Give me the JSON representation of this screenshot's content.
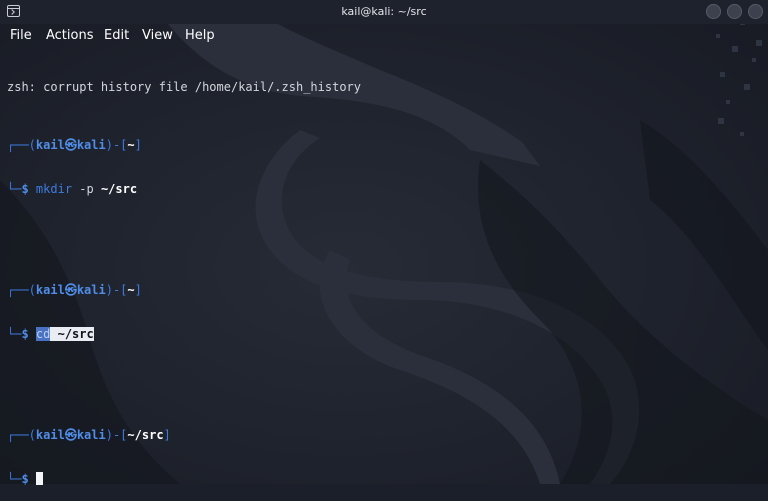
{
  "window": {
    "title": "kail@kali: ~/src"
  },
  "menu": {
    "items": [
      "File",
      "Actions",
      "Edit",
      "View",
      "Help"
    ]
  },
  "terminal": {
    "warning": "zsh: corrupt history file /home/kail/.zsh_history",
    "prompt_user": "kail",
    "prompt_at": "㉿",
    "prompt_host": "kali",
    "prompt_symbol": "$",
    "blocks": [
      {
        "dir": "~",
        "command": "mkdir",
        "args": " -p ",
        "path": "~/src"
      },
      {
        "dir": "~",
        "command": "cd",
        "args": " ",
        "path": "~/src"
      },
      {
        "dir": "~/src",
        "command": "",
        "args": "",
        "path": ""
      }
    ]
  },
  "colors": {
    "background": "#1b1f29",
    "prompt_blue": "#3e7be1",
    "selection": "#4b72c2"
  }
}
